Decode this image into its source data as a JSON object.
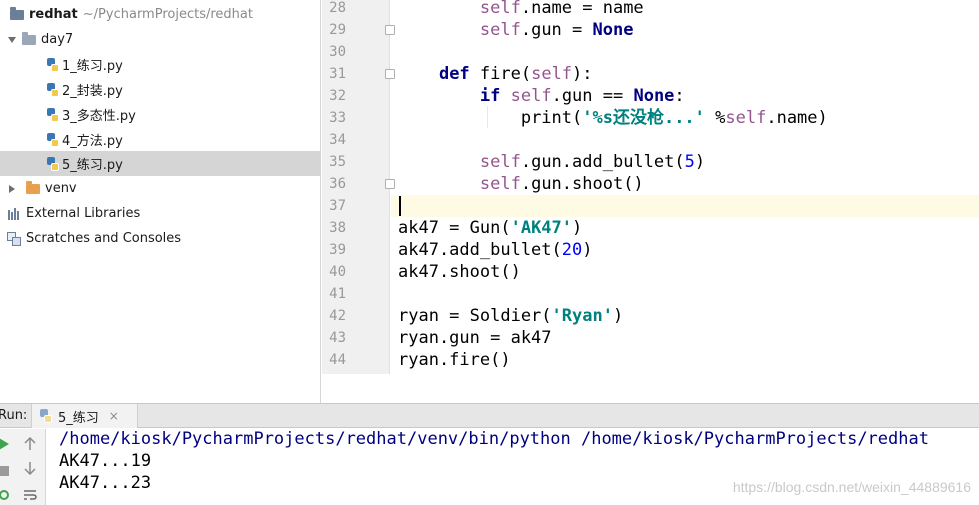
{
  "project_tree": {
    "root": {
      "name": "redhat",
      "path": "~/PycharmProjects/redhat"
    },
    "folder": "day7",
    "files": [
      "1_练习.py",
      "2_封装.py",
      "3_多态性.py",
      "4_方法.py",
      "5_练习.py"
    ],
    "selected_file": "5_练习.py",
    "venv": "venv",
    "external_libraries": "External Libraries",
    "scratches": "Scratches and Consoles"
  },
  "editor": {
    "line_numbers": [
      "28",
      "29",
      "30",
      "31",
      "32",
      "33",
      "34",
      "35",
      "36",
      "37",
      "38",
      "39",
      "40",
      "41",
      "42",
      "43",
      "44"
    ],
    "lines": {
      "l28": {
        "self": "self",
        "rest": ".name = name"
      },
      "l29": {
        "self": "self",
        "attr": ".gun = ",
        "none": "None"
      },
      "l31": {
        "def": "def",
        "name": " fire(",
        "self": "self",
        "close": "):"
      },
      "l32": {
        "if": "if",
        "self": "self",
        "attr": ".gun == ",
        "none": "None",
        "colon": ":"
      },
      "l33": {
        "func": "print(",
        "str": "'%s还没枪...'",
        "mid": " %",
        "self": "self",
        "end": ".name)"
      },
      "l35": {
        "self": "self",
        "call": ".gun.add_bullet(",
        "num": "5",
        "close": ")"
      },
      "l36": {
        "self": "self",
        "call": ".gun.shoot()"
      },
      "l38": {
        "pre": "ak47 = Gun(",
        "str": "'AK47'",
        "close": ")"
      },
      "l39": {
        "pre": "ak47.add_bullet(",
        "num": "20",
        "close": ")"
      },
      "l40": {
        "text": "ak47.shoot()"
      },
      "l42": {
        "pre": "ryan = Soldier(",
        "str": "'Ryan'",
        "close": ")"
      },
      "l43": {
        "text": "ryan.gun = ak47"
      },
      "l44": {
        "text": "ryan.fire()"
      }
    }
  },
  "run_panel": {
    "label": "Run:",
    "tab_name": "5_练习",
    "close_glyph": "×",
    "console": [
      "/home/kiosk/PycharmProjects/redhat/venv/bin/python /home/kiosk/PycharmProjects/redhat",
      "AK47...19",
      "AK47...23"
    ]
  },
  "watermark": "https://blog.csdn.net/weixin_44889616",
  "colors": {
    "keyword": "#000080",
    "self": "#94558d",
    "string": "#008080",
    "number": "#0000ff",
    "selection": "#d5d5d5",
    "current_line": "#fffae3"
  }
}
